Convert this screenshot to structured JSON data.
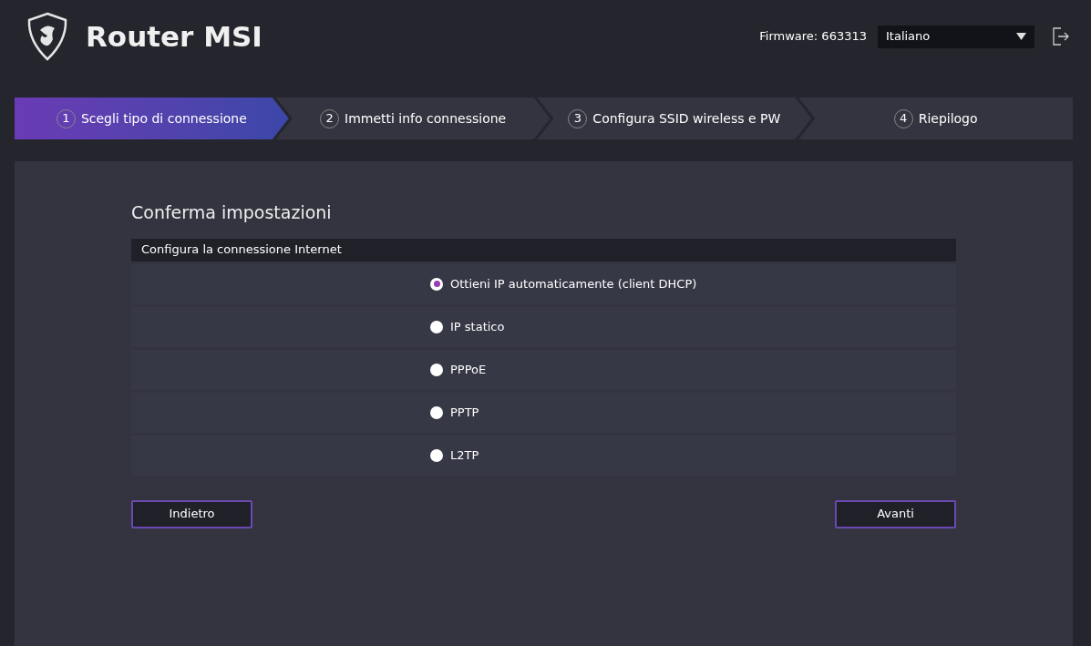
{
  "header": {
    "title": "Router MSI",
    "firmware": "Firmware: 663313",
    "language": "Italiano"
  },
  "steps": [
    {
      "number": "1",
      "label": "Scegli tipo di connessione",
      "selected": true
    },
    {
      "number": "2",
      "label": "Immetti info connessione",
      "selected": false
    },
    {
      "number": "3",
      "label": "Configura SSID wireless e PW",
      "selected": false
    },
    {
      "number": "4",
      "label": "Riepilogo",
      "selected": false
    }
  ],
  "panel": {
    "title": "Conferma impostazioni",
    "section": "Configura la connessione Internet",
    "options": [
      {
        "label": "Ottieni IP automaticamente (client DHCP)",
        "selected": true
      },
      {
        "label": "IP statico",
        "selected": false
      },
      {
        "label": "PPPoE",
        "selected": false
      },
      {
        "label": "PPTP",
        "selected": false
      },
      {
        "label": "L2TP",
        "selected": false
      }
    ],
    "buttons": {
      "back": "Indietro",
      "next": "Avanti"
    }
  }
}
